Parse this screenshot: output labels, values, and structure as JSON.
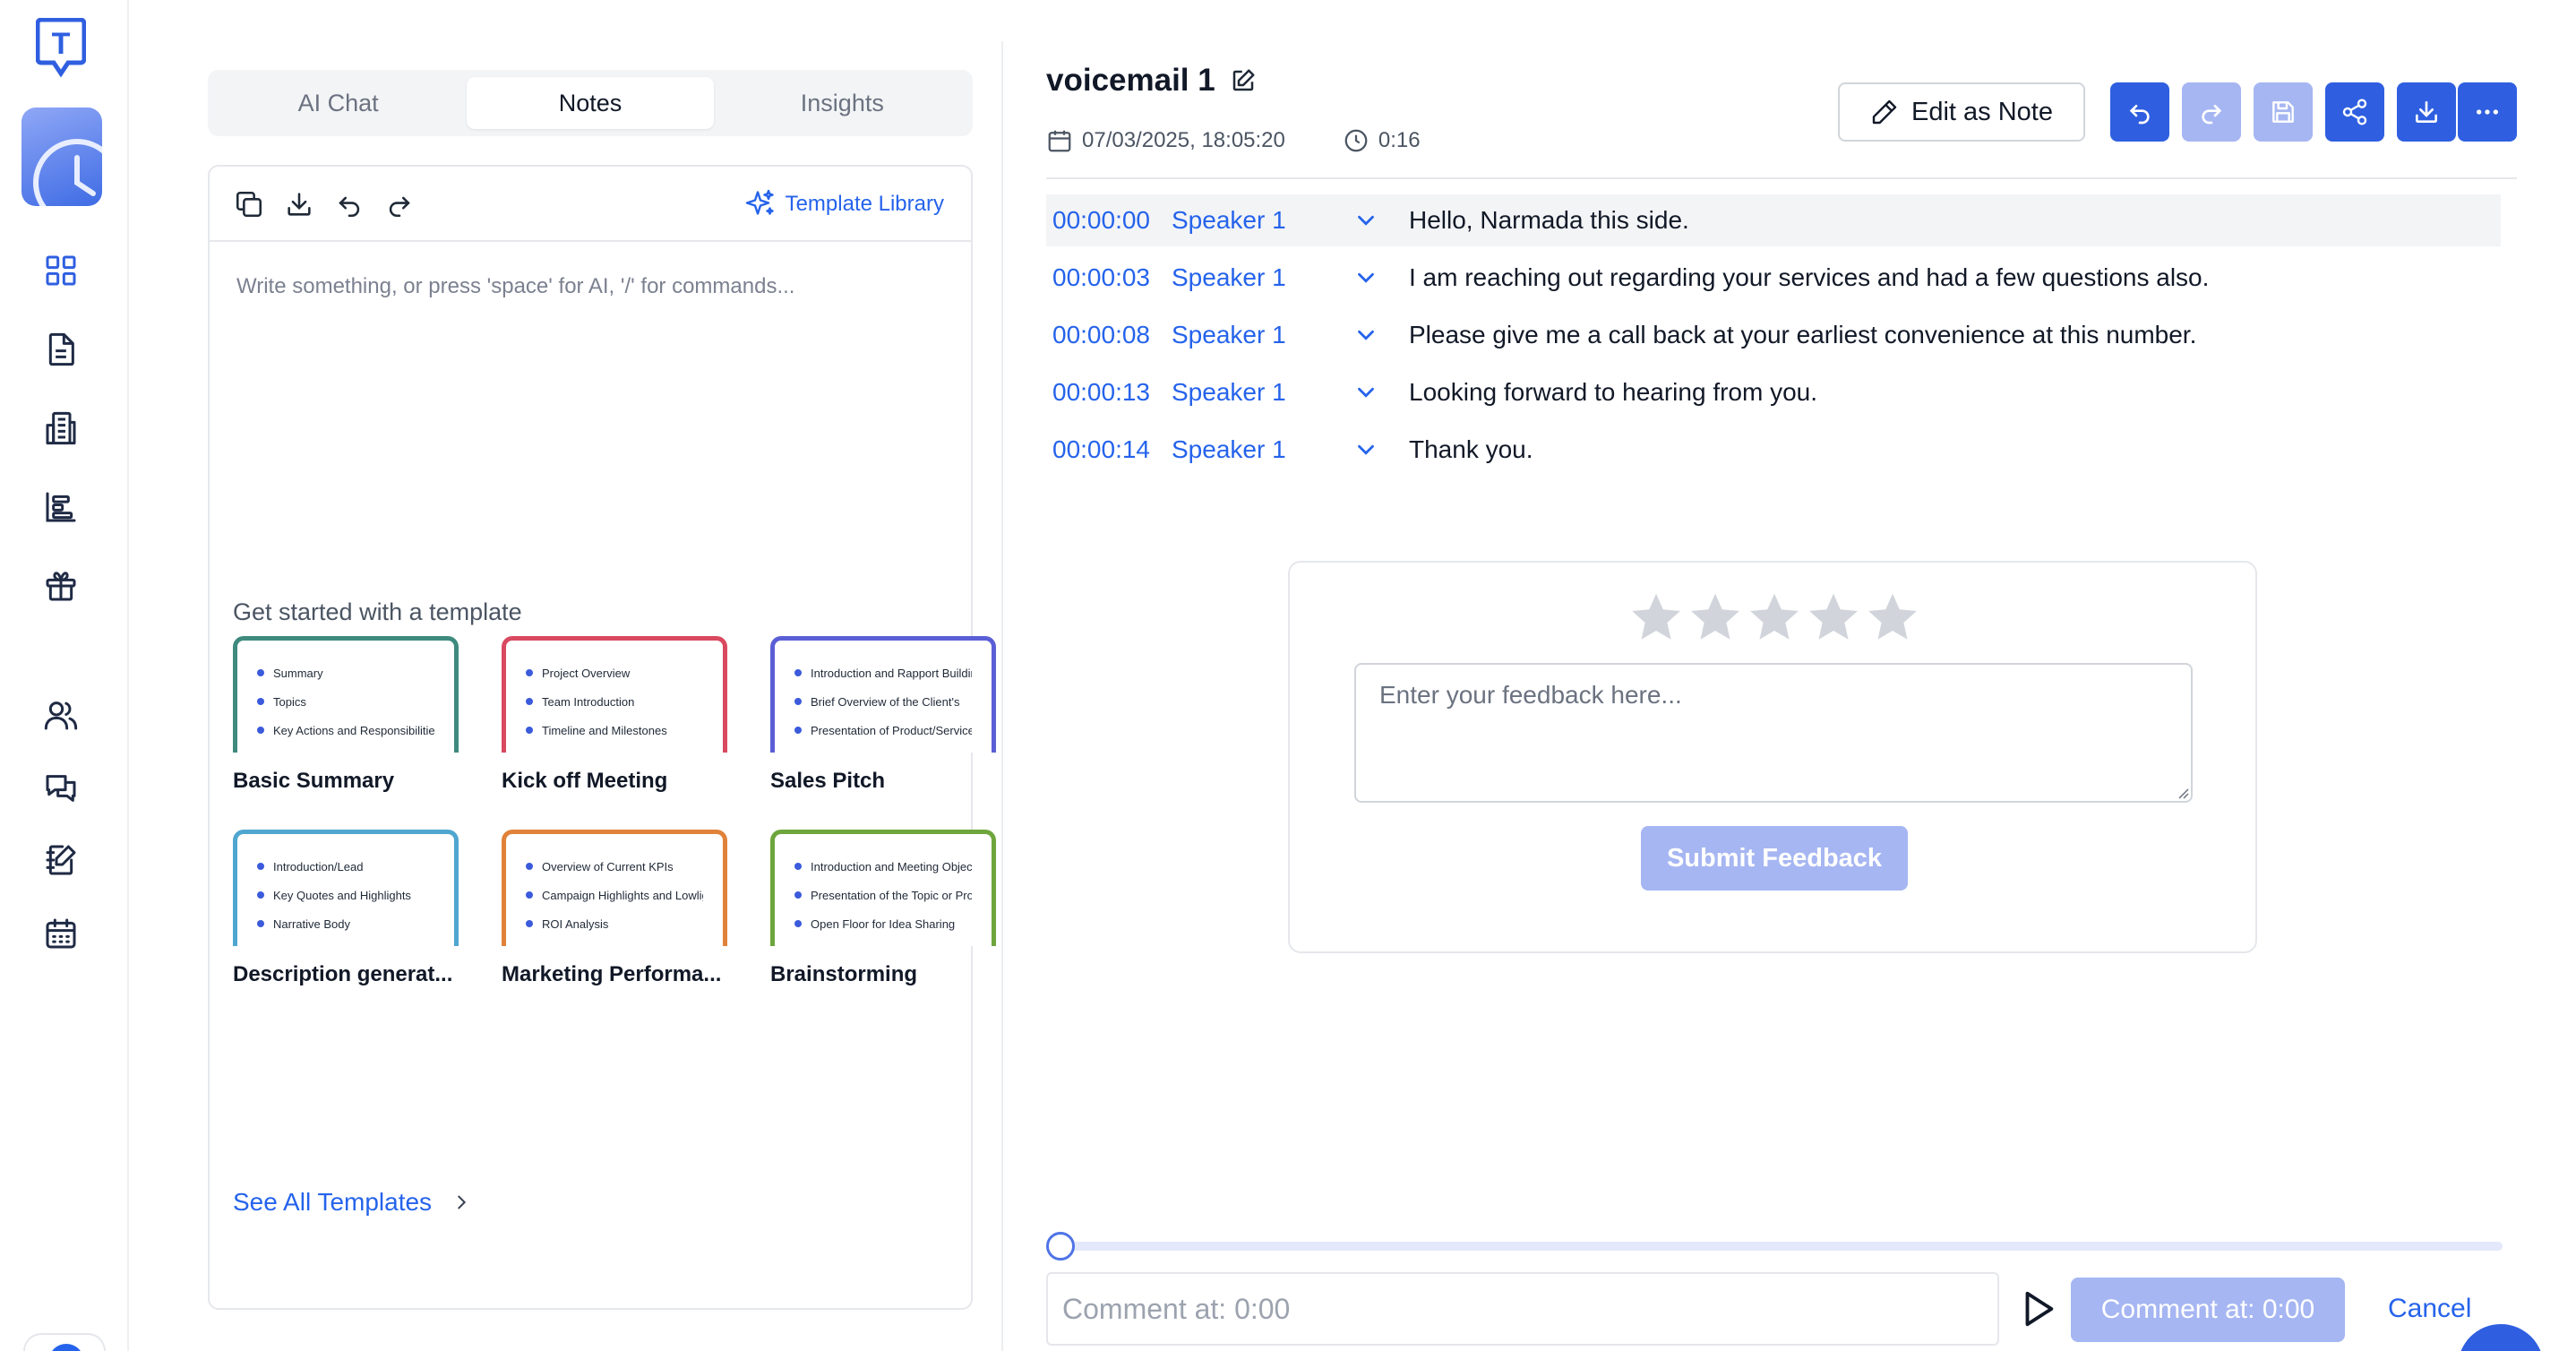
{
  "brand": {
    "logo_letter": "T",
    "accent": "#2f5fe0",
    "link_color": "#2563eb"
  },
  "rail": {
    "items": [
      {
        "icon": "recent-clock-icon",
        "active": true
      },
      {
        "icon": "dashboard-grid-icon"
      },
      {
        "icon": "document-icon"
      },
      {
        "icon": "building-icon"
      },
      {
        "icon": "reports-chart-icon"
      },
      {
        "icon": "gift-icon"
      },
      {
        "icon": "users-icon"
      },
      {
        "icon": "chat-icon"
      },
      {
        "icon": "notebook-edit-icon"
      },
      {
        "icon": "calendar-icon"
      }
    ]
  },
  "tabs": [
    {
      "label": "AI Chat",
      "active": false
    },
    {
      "label": "Notes",
      "active": true
    },
    {
      "label": "Insights",
      "active": false
    }
  ],
  "notes": {
    "toolbar": {
      "template_library_label": "Template Library"
    },
    "editor_placeholder": "Write something, or press 'space' for AI, '/' for commands...",
    "templates_heading": "Get started with a template",
    "templates": [
      {
        "name": "Basic Summary",
        "color": "#3f8a7e",
        "lines": [
          "Summary",
          "Topics",
          "Key Actions and Responsibilities"
        ]
      },
      {
        "name": "Kick off Meeting",
        "color": "#d9495f",
        "lines": [
          "Project Overview",
          "Team Introduction",
          "Timeline and Milestones"
        ]
      },
      {
        "name": "Sales Pitch",
        "color": "#5a5fd6",
        "lines": [
          "Introduction and Rapport Building",
          "Brief Overview of the Client's",
          "Presentation of Product/Service"
        ]
      },
      {
        "name": "Description generat...",
        "color": "#4fa6cf",
        "lines": [
          "Introduction/Lead",
          "Key Quotes and Highlights",
          "Narrative Body"
        ]
      },
      {
        "name": "Marketing Performa...",
        "color": "#e0823a",
        "lines": [
          "Overview of Current KPIs",
          "Campaign Highlights and Lowlights",
          "ROI Analysis"
        ]
      },
      {
        "name": "Brainstorming",
        "color": "#6ea63d",
        "lines": [
          "Introduction and Meeting Objectives",
          "Presentation of the Topic or Problem",
          "Open Floor for Idea Sharing"
        ]
      }
    ],
    "see_all_label": "See All Templates"
  },
  "recording": {
    "title": "voicemail 1",
    "datetime": "07/03/2025, 18:05:20",
    "duration": "0:16",
    "edit_as_note_label": "Edit as Note"
  },
  "transcript": [
    {
      "time": "00:00:00",
      "speaker": "Speaker 1",
      "text": "Hello, Narmada this side.",
      "highlighted": true
    },
    {
      "time": "00:00:03",
      "speaker": "Speaker 1",
      "text": "I am reaching out regarding your services and had a few questions also."
    },
    {
      "time": "00:00:08",
      "speaker": "Speaker 1",
      "text": "Please give me a call back at your earliest convenience at this number."
    },
    {
      "time": "00:00:13",
      "speaker": "Speaker 1",
      "text": "Looking forward to hearing from you."
    },
    {
      "time": "00:00:14",
      "speaker": "Speaker 1",
      "text": "Thank you."
    }
  ],
  "feedback": {
    "rating": 0,
    "max_rating": 5,
    "placeholder": "Enter your feedback here...",
    "submit_label": "Submit Feedback"
  },
  "player": {
    "progress": 0,
    "comment_placeholder": "Comment at: 0:00",
    "comment_button_label": "Comment at: 0:00",
    "cancel_label": "Cancel"
  }
}
